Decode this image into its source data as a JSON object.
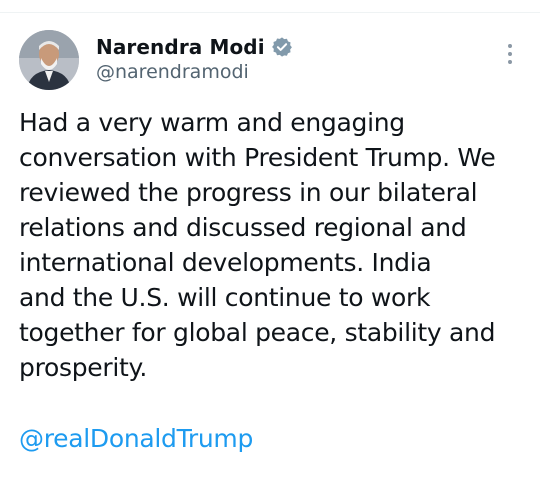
{
  "tweet": {
    "author": {
      "display_name": "Narendra Modi",
      "handle": "@narendramodi",
      "verified": true,
      "avatar_icon": "profile-photo"
    },
    "menu_icon": "more-vertical-icon",
    "text_lines": [
      "Had a very warm and engaging",
      "conversation with President Trump. We",
      "reviewed the progress in our bilateral",
      "relations and discussed regional and",
      "international developments. India",
      "and the U.S. will continue to work",
      "together for global peace, stability and",
      "prosperity."
    ],
    "mention": "@realDonaldTrump"
  },
  "colors": {
    "text": "#0f1419",
    "secondary_text": "#536471",
    "link": "#1d9bf0",
    "verified_badge": "#829aab"
  }
}
